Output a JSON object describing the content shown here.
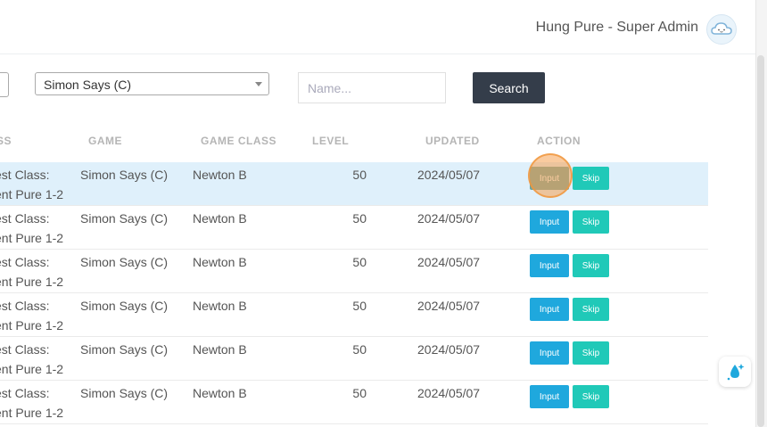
{
  "header": {
    "user_label": "Hung Pure - Super Admin",
    "avatar_icon": "cloud-avatar-icon"
  },
  "filters": {
    "game_select_value": "Simon Says (C)",
    "name_placeholder": "Name...",
    "search_label": "Search"
  },
  "table": {
    "headers": {
      "class": "SS",
      "game": "GAME",
      "game_class": "GAME CLASS",
      "level": "LEVEL",
      "updated": "UPDATED",
      "action": "ACTION"
    },
    "rows": [
      {
        "class_line1": "est Class:",
        "class_line2": "ent Pure 1-2",
        "game": "Simon Says (C)",
        "game_class": "Newton B",
        "level": "50",
        "updated": "2024/05/07",
        "input_label": "Input",
        "skip_label": "Skip"
      },
      {
        "class_line1": "est Class:",
        "class_line2": "ent Pure 1-2",
        "game": "Simon Says (C)",
        "game_class": "Newton B",
        "level": "50",
        "updated": "2024/05/07",
        "input_label": "Input",
        "skip_label": "Skip"
      },
      {
        "class_line1": "est Class:",
        "class_line2": "ent Pure 1-2",
        "game": "Simon Says (C)",
        "game_class": "Newton B",
        "level": "50",
        "updated": "2024/05/07",
        "input_label": "Input",
        "skip_label": "Skip"
      },
      {
        "class_line1": "est Class:",
        "class_line2": "ent Pure 1-2",
        "game": "Simon Says (C)",
        "game_class": "Newton B",
        "level": "50",
        "updated": "2024/05/07",
        "input_label": "Input",
        "skip_label": "Skip"
      },
      {
        "class_line1": "est Class:",
        "class_line2": "ent Pure 1-2",
        "game": "Simon Says (C)",
        "game_class": "Newton B",
        "level": "50",
        "updated": "2024/05/07",
        "input_label": "Input",
        "skip_label": "Skip"
      },
      {
        "class_line1": "est Class:",
        "class_line2": "ent Pure 1-2",
        "game": "Simon Says (C)",
        "game_class": "Newton B",
        "level": "50",
        "updated": "2024/05/07",
        "input_label": "Input",
        "skip_label": "Skip"
      }
    ]
  },
  "colors": {
    "search_button": "#343d4a",
    "input_button": "#1fa8dd",
    "skip_button": "#20c9b8",
    "highlight_row": "#dff0fb"
  }
}
